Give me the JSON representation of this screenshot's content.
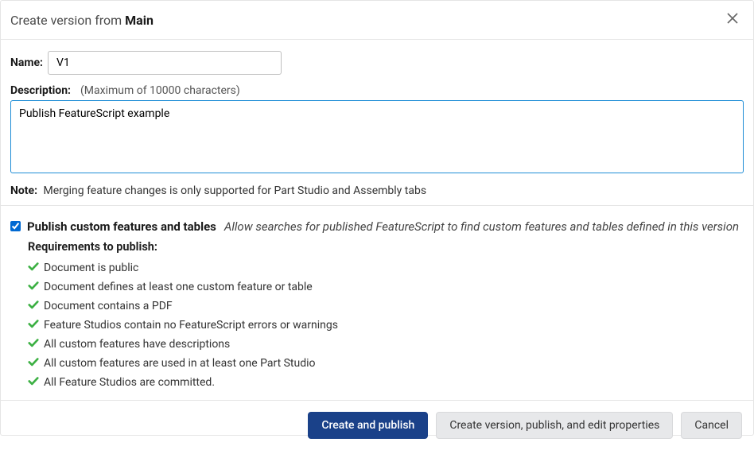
{
  "header": {
    "title_prefix": "Create version from",
    "title_target": "Main"
  },
  "form": {
    "name_label": "Name:",
    "name_value": "V1",
    "description_label": "Description:",
    "description_hint": "(Maximum of 10000 characters)",
    "description_value": "Publish FeatureScript example",
    "note_label": "Note:",
    "note_text": "Merging feature changes is only supported for Part Studio and Assembly tabs"
  },
  "publish": {
    "checked": true,
    "label": "Publish custom features and tables",
    "description": "Allow searches for published FeatureScript to find custom features and tables defined in this version",
    "requirements_title": "Requirements to publish:",
    "requirements": [
      "Document is public",
      "Document defines at least one custom feature or table",
      "Document contains a PDF",
      "Feature Studios contain no FeatureScript errors or warnings",
      "All custom features have descriptions",
      "All custom features are used in at least one Part Studio",
      "All Feature Studios are committed."
    ]
  },
  "buttons": {
    "create_publish": "Create and publish",
    "create_publish_edit": "Create version, publish, and edit properties",
    "cancel": "Cancel"
  }
}
